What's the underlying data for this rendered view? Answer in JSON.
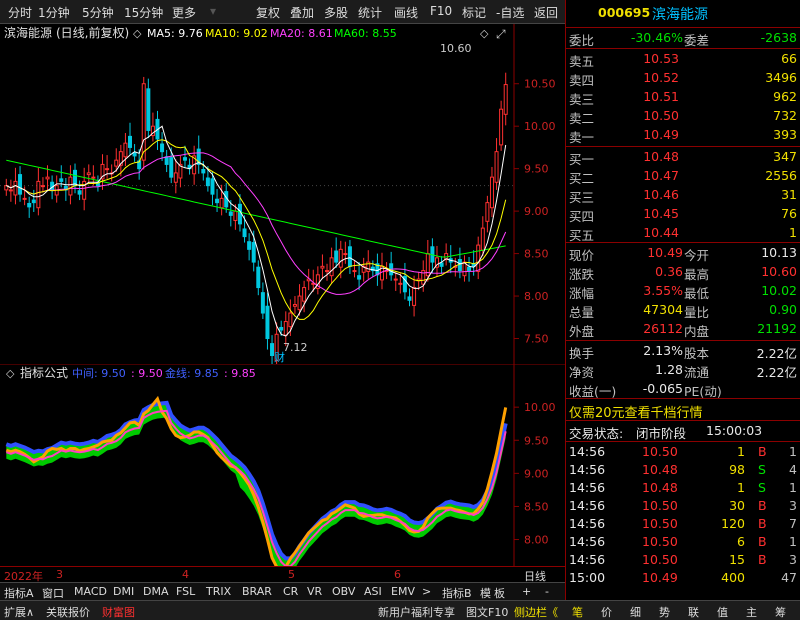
{
  "toolbar": {
    "periods": [
      "分时",
      "1分钟",
      "5分钟",
      "15分钟",
      "更多"
    ],
    "tools": [
      "复权",
      "叠加",
      "多股",
      "统计",
      "画线",
      "F10",
      "标记",
      "-自选",
      "返回"
    ]
  },
  "chart_header": {
    "stock": "滨海能源",
    "mode": "(日线,前复权)",
    "ma5": "MA5: 9.76",
    "ma10": "MA10: 9.02",
    "ma20": "MA20: 8.61",
    "ma60": "MA60: 8.55",
    "colors": {
      "ma5": "#ffffff",
      "ma10": "#ffff00",
      "ma20": "#ff40ff",
      "ma60": "#00ff00"
    }
  },
  "main_axis": {
    "ticks": [
      "10.50",
      "10.00",
      "9.50",
      "9.00",
      "8.50",
      "8.00",
      "7.50"
    ],
    "values": [
      10.5,
      10.0,
      9.5,
      9.0,
      8.5,
      8.0,
      7.5
    ],
    "range": [
      7.2,
      10.85
    ]
  },
  "annotations": {
    "high": "10.60",
    "low": "7.12",
    "fin": "财"
  },
  "sub_header": {
    "name": "指标公式",
    "mid": "中间: 9.50",
    "mid_val": ": 9.50",
    "gold": "金线: 9.85",
    "gold_val": ": 9.85"
  },
  "sub_axis": {
    "ticks": [
      "10.00",
      "9.50",
      "9.00",
      "8.50",
      "8.00"
    ],
    "values": [
      10.0,
      9.5,
      9.0,
      8.5,
      8.0
    ],
    "range": [
      7.6,
      10.35
    ]
  },
  "time_axis": {
    "labels": [
      "2022年",
      "3",
      "4",
      "5",
      "6"
    ],
    "right": "日线"
  },
  "tabs": [
    "指标A",
    "窗口",
    "MACD",
    "DMI",
    "DMA",
    "FSL",
    "TRIX",
    "BRAR",
    "CR",
    "VR",
    "OBV",
    "ASI",
    "EMV",
    ">",
    "指标B",
    "模",
    "板",
    "+",
    "-"
  ],
  "bottom": {
    "left": [
      "扩展∧",
      "关联报价",
      "财富图"
    ],
    "right": [
      "新用户福利专享",
      "图文F10",
      "侧边栏《"
    ],
    "panel_tabs": [
      "笔",
      "价",
      "细",
      "势",
      "联",
      "值",
      "主",
      "筹"
    ]
  },
  "quote": {
    "code": "000695",
    "name": "滨海能源",
    "weibi_label": "委比",
    "weibi": "-30.46%",
    "weicha_label": "委差",
    "weicha": "-2638",
    "sells": [
      {
        "label": "卖五",
        "price": "10.53",
        "vol": "66"
      },
      {
        "label": "卖四",
        "price": "10.52",
        "vol": "3496"
      },
      {
        "label": "卖三",
        "price": "10.51",
        "vol": "962"
      },
      {
        "label": "卖二",
        "price": "10.50",
        "vol": "732"
      },
      {
        "label": "卖一",
        "price": "10.49",
        "vol": "393"
      }
    ],
    "buys": [
      {
        "label": "买一",
        "price": "10.48",
        "vol": "347"
      },
      {
        "label": "买二",
        "price": "10.47",
        "vol": "2556"
      },
      {
        "label": "买三",
        "price": "10.46",
        "vol": "31"
      },
      {
        "label": "买四",
        "price": "10.45",
        "vol": "76"
      },
      {
        "label": "买五",
        "price": "10.44",
        "vol": "1"
      }
    ],
    "stats": [
      {
        "l1": "现价",
        "v1": "10.49",
        "c1": "red",
        "l2": "今开",
        "v2": "10.13",
        "c2": "white"
      },
      {
        "l1": "涨跌",
        "v1": "0.36",
        "c1": "red",
        "l2": "最高",
        "v2": "10.60",
        "c2": "red"
      },
      {
        "l1": "涨幅",
        "v1": "3.55%",
        "c1": "red",
        "l2": "最低",
        "v2": "10.02",
        "c2": "green"
      },
      {
        "l1": "总量",
        "v1": "47304",
        "c1": "yellow",
        "l2": "量比",
        "v2": "0.90",
        "c2": "green"
      },
      {
        "l1": "外盘",
        "v1": "26112",
        "c1": "red",
        "l2": "内盘",
        "v2": "21192",
        "c2": "green"
      }
    ],
    "stats2": [
      {
        "l1": "换手",
        "v1": "2.13%",
        "l2": "股本",
        "v2": "2.22亿"
      },
      {
        "l1": "净资",
        "v1": "1.28",
        "l2": "流通",
        "v2": "2.22亿"
      },
      {
        "l1": "收益(一)",
        "v1": "-0.065",
        "l2": "PE(动)",
        "v2": ""
      }
    ],
    "promo": "仅需20元查看千档行情",
    "status_label": "交易状态:",
    "status": "闭市阶段",
    "status_time": "15:00:03",
    "ticks": [
      {
        "t": "14:56",
        "p": "10.50",
        "v": "1",
        "f": "B",
        "n": "1"
      },
      {
        "t": "14:56",
        "p": "10.48",
        "v": "98",
        "f": "S",
        "n": "4"
      },
      {
        "t": "14:56",
        "p": "10.48",
        "v": "1",
        "f": "S",
        "n": "1"
      },
      {
        "t": "14:56",
        "p": "10.50",
        "v": "30",
        "f": "B",
        "n": "3"
      },
      {
        "t": "14:56",
        "p": "10.50",
        "v": "120",
        "f": "B",
        "n": "7"
      },
      {
        "t": "14:56",
        "p": "10.50",
        "v": "6",
        "f": "B",
        "n": "1"
      },
      {
        "t": "14:56",
        "p": "10.50",
        "v": "15",
        "f": "B",
        "n": "3"
      },
      {
        "t": "15:00",
        "p": "10.49",
        "v": "400",
        "f": "",
        "n": "47"
      }
    ]
  },
  "chart_data": {
    "type": "candlestick",
    "close": [
      9.3,
      9.25,
      9.35,
      9.2,
      9.15,
      9.05,
      9.1,
      9.35,
      9.3,
      9.4,
      9.25,
      9.3,
      9.35,
      9.25,
      9.4,
      9.3,
      9.2,
      9.35,
      9.45,
      9.4,
      9.3,
      9.55,
      9.5,
      9.45,
      9.6,
      9.7,
      9.8,
      9.75,
      9.65,
      9.5,
      10.5,
      9.95,
      10.0,
      9.85,
      9.7,
      9.55,
      9.4,
      9.45,
      9.55,
      9.6,
      9.5,
      9.65,
      9.55,
      9.45,
      9.3,
      9.2,
      9.1,
      9.15,
      9.05,
      8.95,
      9.0,
      8.85,
      8.7,
      8.55,
      8.4,
      8.1,
      7.8,
      7.5,
      7.3,
      7.55,
      7.6,
      7.7,
      7.8,
      7.9,
      8.0,
      8.1,
      8.2,
      8.15,
      8.25,
      8.35,
      8.3,
      8.45,
      8.4,
      8.55,
      8.5,
      8.35,
      8.3,
      8.2,
      8.35,
      8.4,
      8.3,
      8.25,
      8.35,
      8.3,
      8.25,
      8.2,
      8.15,
      8.05,
      7.95,
      8.1,
      8.2,
      8.3,
      8.5,
      8.4,
      8.45,
      8.35,
      8.5,
      8.4,
      8.35,
      8.3,
      8.4,
      8.3,
      8.35,
      8.6,
      8.8,
      9.1,
      9.4,
      9.7,
      10.2,
      10.49
    ],
    "ma5": [],
    "ma10": [],
    "ma20": [],
    "ma60": [],
    "sub_mid": [],
    "sub_gold": []
  }
}
